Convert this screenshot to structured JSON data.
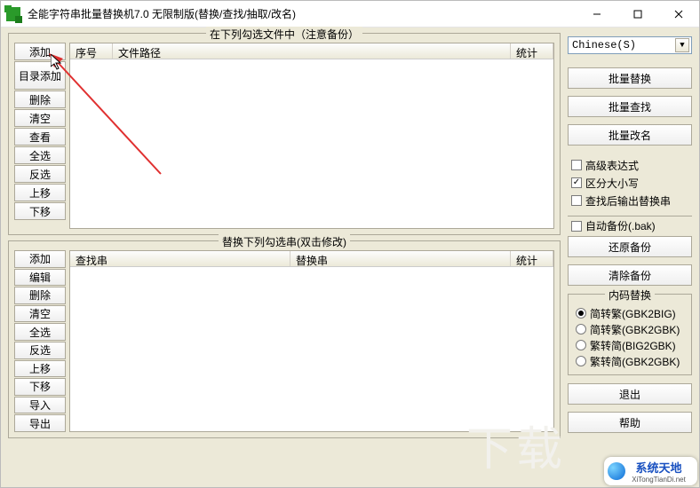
{
  "window": {
    "title": "全能字符串批量替换机7.0 无限制版(替换/查找/抽取/改名)"
  },
  "group_files": {
    "label": "在下列勾选文件中（注意备份）",
    "buttons": {
      "add": "添加",
      "add_dir": "目录添加",
      "delete": "删除",
      "clear": "清空",
      "view": "查看",
      "select_all": "全选",
      "invert": "反选",
      "move_up": "上移",
      "move_down": "下移"
    },
    "columns": {
      "index": "序号",
      "path": "文件路径",
      "stat": "统计"
    }
  },
  "group_strings": {
    "label": "替换下列勾选串(双击修改)",
    "buttons": {
      "add": "添加",
      "edit": "编辑",
      "delete": "删除",
      "clear": "清空",
      "select_all": "全选",
      "invert": "反选",
      "move_up": "上移",
      "move_down": "下移",
      "import": "导入",
      "export": "导出"
    },
    "columns": {
      "find": "查找串",
      "replace": "替换串",
      "stat": "统计"
    }
  },
  "right": {
    "language_selected": "Chinese(S)",
    "batch_replace": "批量替换",
    "batch_find": "批量查找",
    "batch_rename": "批量改名",
    "adv_regex": "高级表达式",
    "case_sensitive": "区分大小写",
    "output_after_find": "查找后输出替换串",
    "auto_backup": "自动备份(.bak)",
    "restore_backup": "还原备份",
    "clear_backup": "清除备份",
    "encoding_group": "内码替换",
    "enc_s2b_gbk2big": "简转繁(GBK2BIG)",
    "enc_s2b_gbk2gbk": "简转繁(GBK2GBK)",
    "enc_b2s_big2gbk": "繁转简(BIG2GBK)",
    "enc_b2s_gbk2gbk": "繁转简(GBK2GBK)",
    "exit": "退出",
    "help": "帮助"
  },
  "watermark": {
    "line1": "系统天地",
    "line2": "XiTongTianDi.net"
  },
  "bg_text": "下载"
}
